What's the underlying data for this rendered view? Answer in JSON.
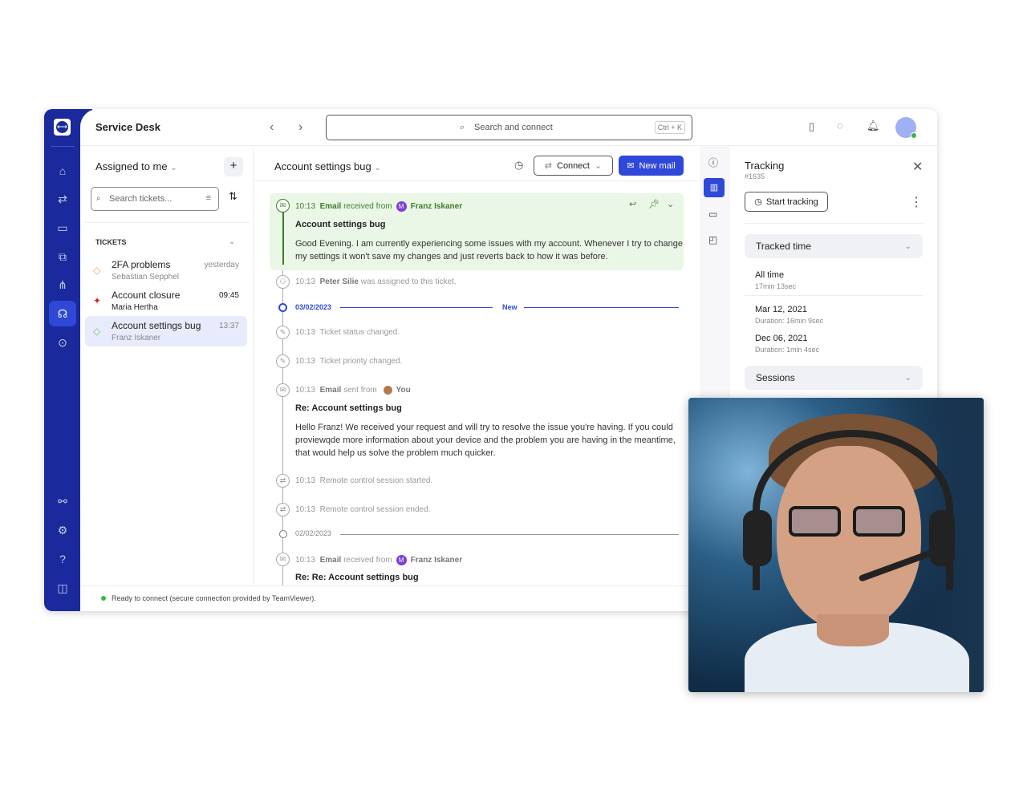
{
  "app": {
    "title": "Service Desk",
    "search_placeholder": "Search and connect",
    "search_shortcut": "Ctrl + K"
  },
  "rail": {
    "items": [
      "home",
      "remote-connect",
      "devices",
      "sessions",
      "workflows",
      "service-desk",
      "settings-device",
      "integrations",
      "settings",
      "help",
      "layout"
    ]
  },
  "list": {
    "filter_label": "Assigned to me",
    "search_placeholder": "Search tickets...",
    "section": "TICKETS",
    "tickets": [
      {
        "title": "2FA problems",
        "person": "Sebastian Sepphel",
        "time": "yesterday",
        "color": "#f29a55"
      },
      {
        "title": "Account closure",
        "person": "Maria Hertha",
        "time": "09:45",
        "color": "#c8282c"
      },
      {
        "title": "Account settings bug",
        "person": "Franz Iskaner",
        "time": "13:37",
        "color": "#6cc46a"
      }
    ]
  },
  "ticket": {
    "title": "Account settings bug",
    "connect_label": "Connect",
    "new_mail_label": "New mail",
    "events": {
      "e1": {
        "time": "10:13",
        "kind": "Email",
        "verb": "received from",
        "avatar": "M",
        "who": "Franz Iskaner",
        "subject": "Account settings bug",
        "body": "Good Evening. I am currently experiencing some issues with my account. Whenever I try to change my settings it won't save my changes and just reverts back to how it was before."
      },
      "e2": {
        "time": "10:13",
        "who": "Peter Silie",
        "text": "was assigned to this ticket."
      },
      "d1": {
        "date": "03/02/2023",
        "label": "New"
      },
      "e3": {
        "time": "10:13",
        "text": "Ticket status changed."
      },
      "e4": {
        "time": "10:13",
        "text": "Ticket priority changed."
      },
      "e5": {
        "time": "10:13",
        "kind": "Email",
        "verb": "sent from",
        "who": "You",
        "subject": "Re: Account settings bug",
        "body": "Hello Franz! We received your request and will try to resolve the issue you're having.  If you could proviewqde more information about your device and the problem you are having in the meantime, that would help us solve the problem much quicker."
      },
      "e6": {
        "time": "10:13",
        "text": "Remote control session started."
      },
      "e7": {
        "time": "10:13",
        "text": "Remote control session ended."
      },
      "d2": {
        "date": "02/02/2023"
      },
      "e8": {
        "time": "10:13",
        "kind": "Email",
        "verb": "received from",
        "avatar": "M",
        "who": "Franz Iskaner",
        "subject": "Re: Re: Account settings bug"
      }
    }
  },
  "status": {
    "text": "Ready to connect (secure connection provided by TeamViewer).",
    "color": "#3bb54a"
  },
  "tracking": {
    "title": "Tracking",
    "id": "#1635",
    "start_label": "Start tracking",
    "tracked_label": "Tracked time",
    "all_time_label": "All time",
    "all_time_value": "17min 13sec",
    "entries": [
      {
        "date": "Mar 12, 2021",
        "duration": "Duration: 16min 9sec"
      },
      {
        "date": "Dec 06, 2021",
        "duration": "Duration: 1min 4sec"
      }
    ],
    "sessions_label": "Sessions"
  },
  "colors": {
    "brand": "#1a2a9c",
    "accent": "#2f48d8",
    "email_bg": "#eaf6e6",
    "email_green": "#3d7d2b"
  }
}
